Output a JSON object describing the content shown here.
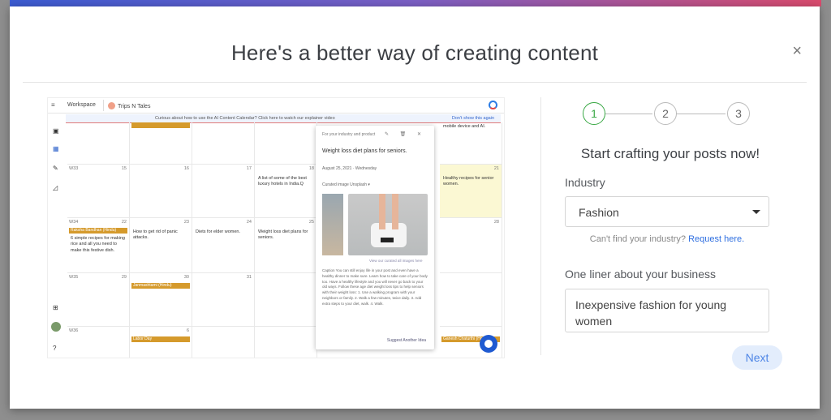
{
  "modal": {
    "title": "Here's a better way of creating content",
    "close_label": "×"
  },
  "preview": {
    "workspace_label": "Workspace",
    "brand_name": "Trips N Tales",
    "banner_text": "Curious about how to use the AI Content Calendar? Click here to watch our explainer video",
    "dont_show": "Don't show this again",
    "top_right_note": "mobile device and AI.",
    "cells": [
      {
        "wk": "W33",
        "num": "15",
        "ev": ""
      },
      {
        "wk": "",
        "num": "16",
        "ev": ""
      },
      {
        "wk": "",
        "num": "17",
        "ev": ""
      },
      {
        "wk": "",
        "num": "18",
        "ev": "A list of some of the best luxury hotels in India.Q"
      },
      {
        "wk": "",
        "num": "21",
        "ev": "Healthy recipes for senior women."
      },
      {
        "wk": "W34",
        "num": "22",
        "ev": "6 simple recipes for making rice and all you need to make this festive dish."
      },
      {
        "wk": "",
        "num": "23",
        "ev": "How to get rid of panic attacks."
      },
      {
        "wk": "",
        "num": "24",
        "ev": "Diets for elder women."
      },
      {
        "wk": "",
        "num": "25",
        "ev": "Weight loss diet plans for seniors."
      },
      {
        "wk": "",
        "num": "28",
        "ev": ""
      },
      {
        "wk": "W35",
        "num": "29",
        "ev": ""
      },
      {
        "wk": "",
        "num": "30",
        "ev": ""
      },
      {
        "wk": "",
        "num": "31",
        "ev": ""
      },
      {
        "wk": "W36",
        "num": "5",
        "ev": ""
      },
      {
        "wk": "",
        "num": "6",
        "ev": ""
      }
    ],
    "bars": {
      "raksha": "Raksha Bandhan (Hindu)",
      "janmashtami": "Janmashtami (Hindu)",
      "labor": "Labor Day",
      "ganesh": "Ganesh Chaturthi (Hindu)"
    },
    "popup": {
      "top": "For your industry and product",
      "icons": "✎ 🗑 ✕",
      "title": "Weight loss diet plans for seniors.",
      "date": "August 25, 2021 · Wednesday",
      "curated": "Curated image  Unsplash ▾",
      "view_more": "View our curated all images here",
      "caption": "Caption You can still enjoy life in your post and even have a healthy dinner to make sure. Learn how to take care of your body too. Have a healthy lifestyle and you will never go back to your old ways. Follow these age diet weight loss tips to help seniors with their weight loss: 1. Use a walking program with your neighbors or family. 2. Walk a few minutes, twice daily. 3. Add extra steps to your diet, walk. 4. Walk.",
      "suggest": "Suggest Another Idea"
    }
  },
  "wizard": {
    "steps": [
      "1",
      "2",
      "3"
    ],
    "active_step": 1,
    "heading": "Start crafting your posts now!",
    "industry_label": "Industry",
    "industry_value": "Fashion",
    "cant_find": "Can't find your industry?",
    "request_link": "Request here.",
    "oneliner_label": "One liner about your business",
    "oneliner_value": "Inexpensive fashion for young women",
    "next_label": "Next"
  },
  "colors": {
    "accent": "#2f6fe0",
    "step_active": "#3aa845",
    "next_bg": "#e3edfc",
    "event_bar": "#d59a2c",
    "highlight_cell": "#fbf8d3"
  }
}
